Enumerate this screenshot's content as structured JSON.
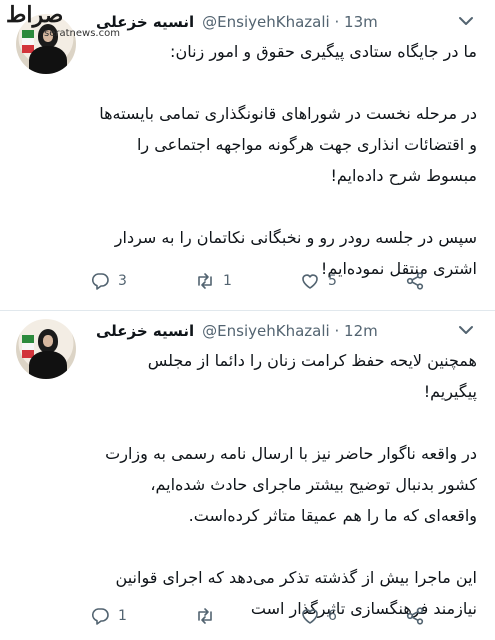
{
  "watermark": {
    "logo_text": "صراط",
    "site": "seratnews.com"
  },
  "tweets": [
    {
      "author_name": "انسیه خزعلی",
      "handle": "@EnsiyehKhazali",
      "separator": "·",
      "time": "13m",
      "paragraphs": [
        "ما در جایگاه ستادی پیگیری حقوق و امور زنان:",
        "در مرحله نخست در شوراهای قانونگذاری تمامی بایسته‌ها و اقتضائات انذاری جهت هرگونه مواجهه اجتماعی را مبسوط شرح داده‌ایم!",
        "سپس در جلسه رودر رو و نخبگانی نکاتمان را به سردار اشتری منتقل نموده‌ایم!"
      ],
      "replies": "3",
      "retweets": "1",
      "likes": "5"
    },
    {
      "author_name": "انسیه خزعلی",
      "handle": "@EnsiyehKhazali",
      "separator": "·",
      "time": "12m",
      "paragraphs": [
        "همچنین لایحه حفظ کرامت زنان را دائما از مجلس پیگیریم!",
        "در واقعه ناگوار حاضر نیز با ارسال نامه رسمی به وزارت کشور بدنبال توضیح بیشتر ماجرای حادث شده‌ایم، واقعه‌ای که ما را هم عمیقا متاثر کرده‌است.",
        "این ماجرا بیش از گذشته تذکر می‌دهد که اجرای قوانین نیازمند فرهنگسازی تاثیرگذار است"
      ],
      "replies": "1",
      "retweets": "",
      "likes": "6"
    }
  ],
  "colors": {
    "text": "#0f1419",
    "secondary": "#536471",
    "divider": "#e1e8ed",
    "background": "#ffffff"
  },
  "icons": [
    "caret-down-icon",
    "reply-icon",
    "retweet-icon",
    "like-icon",
    "share-icon"
  ]
}
